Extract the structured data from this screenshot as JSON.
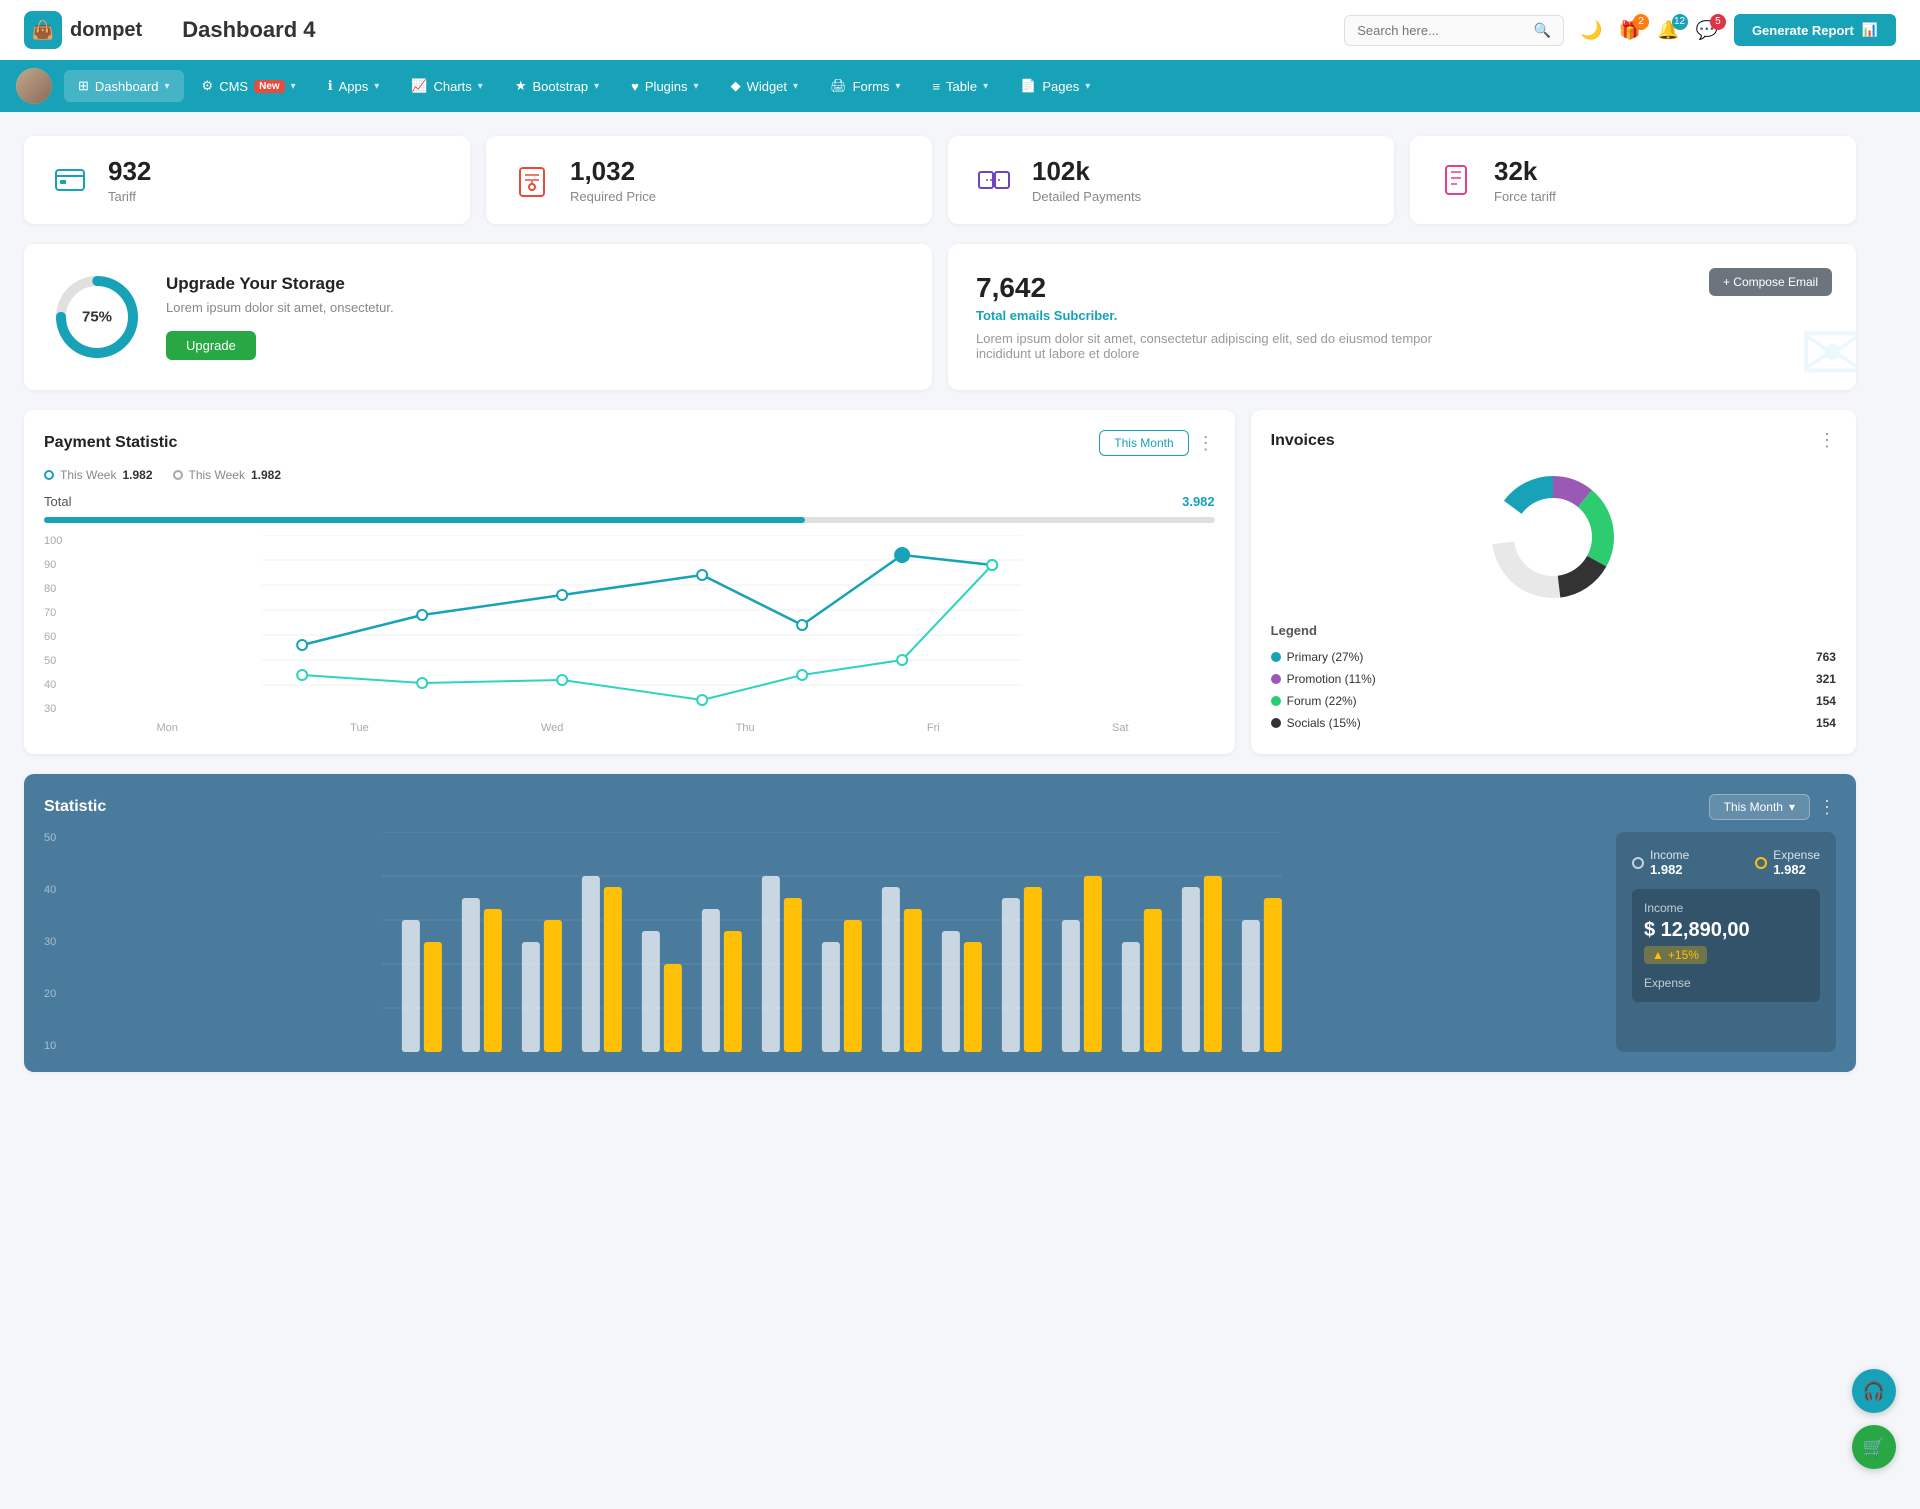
{
  "header": {
    "logo_icon": "💼",
    "logo_text": "dompet",
    "page_title": "Dashboard 4",
    "search_placeholder": "Search here...",
    "generate_report_label": "Generate Report",
    "icons": {
      "gift_badge": "2",
      "bell_badge": "12",
      "chat_badge": "5"
    }
  },
  "navbar": {
    "items": [
      {
        "label": "Dashboard",
        "icon": "⊞",
        "has_arrow": true,
        "active": true
      },
      {
        "label": "CMS",
        "icon": "⚙",
        "has_arrow": true,
        "badge": "New"
      },
      {
        "label": "Apps",
        "icon": "ℹ",
        "has_arrow": true
      },
      {
        "label": "Charts",
        "icon": "📈",
        "has_arrow": true
      },
      {
        "label": "Bootstrap",
        "icon": "★",
        "has_arrow": true
      },
      {
        "label": "Plugins",
        "icon": "♥",
        "has_arrow": true
      },
      {
        "label": "Widget",
        "icon": "♦",
        "has_arrow": true
      },
      {
        "label": "Forms",
        "icon": "🖨",
        "has_arrow": true
      },
      {
        "label": "Table",
        "icon": "≡",
        "has_arrow": true
      },
      {
        "label": "Pages",
        "icon": "📄",
        "has_arrow": true
      }
    ]
  },
  "stat_cards": [
    {
      "number": "932",
      "label": "Tariff",
      "icon_color": "#17a2b8"
    },
    {
      "number": "1,032",
      "label": "Required Price",
      "icon_color": "#e74c3c"
    },
    {
      "number": "102k",
      "label": "Detailed Payments",
      "icon_color": "#6f42c1"
    },
    {
      "number": "32k",
      "label": "Force tariff",
      "icon_color": "#e83e8c"
    }
  ],
  "storage": {
    "percent": "75%",
    "title": "Upgrade Your Storage",
    "desc": "Lorem ipsum dolor sit amet, onsectetur.",
    "btn_label": "Upgrade"
  },
  "email": {
    "number": "7,642",
    "subtitle": "Total emails Subcriber.",
    "desc": "Lorem ipsum dolor sit amet, consectetur adipiscing elit, sed do eiusmod tempor incididunt ut labore et dolore",
    "compose_btn": "+ Compose Email"
  },
  "payment_statistic": {
    "title": "Payment Statistic",
    "filter_label": "This Month",
    "legend": [
      {
        "label": "This Week",
        "value": "1.982",
        "color": "#17a2b8"
      },
      {
        "label": "This Week",
        "value": "1.982",
        "color": "#aaa"
      }
    ],
    "total_label": "Total",
    "total_value": "3.982",
    "progress_percent": 65,
    "x_labels": [
      "Mon",
      "Tue",
      "Wed",
      "Thu",
      "Fri",
      "Sat"
    ],
    "y_labels": [
      "100",
      "90",
      "80",
      "70",
      "60",
      "50",
      "40",
      "30"
    ],
    "line1_points": "40,160 120,130 240,110 360,80 480,120 600,60 720,80",
    "line2_points": "40,140 120,148 240,145 360,165 480,145 600,130 720,80"
  },
  "invoices": {
    "title": "Invoices",
    "legend": [
      {
        "label": "Primary (27%)",
        "value": "763",
        "color": "#17a2b8"
      },
      {
        "label": "Promotion (11%)",
        "value": "321",
        "color": "#9b59b6"
      },
      {
        "label": "Forum (22%)",
        "value": "154",
        "color": "#2ecc71"
      },
      {
        "label": "Socials (15%)",
        "value": "154",
        "color": "#333"
      }
    ],
    "donut_segments": [
      {
        "pct": 27,
        "color": "#17a2b8"
      },
      {
        "pct": 11,
        "color": "#9b59b6"
      },
      {
        "pct": 22,
        "color": "#2ecc71"
      },
      {
        "pct": 15,
        "color": "#222"
      },
      {
        "pct": 25,
        "color": "#e0e0e0"
      }
    ]
  },
  "statistic": {
    "title": "Statistic",
    "filter_label": "This Month",
    "y_labels": [
      "50",
      "40",
      "30",
      "20",
      "10"
    ],
    "income_label": "Income",
    "income_value": "1.982",
    "expense_label": "Expense",
    "expense_value": "1.982",
    "income_box": {
      "label": "Income",
      "amount": "$ 12,890,00",
      "change": "+15%"
    },
    "expense_box_label": "Expense"
  }
}
